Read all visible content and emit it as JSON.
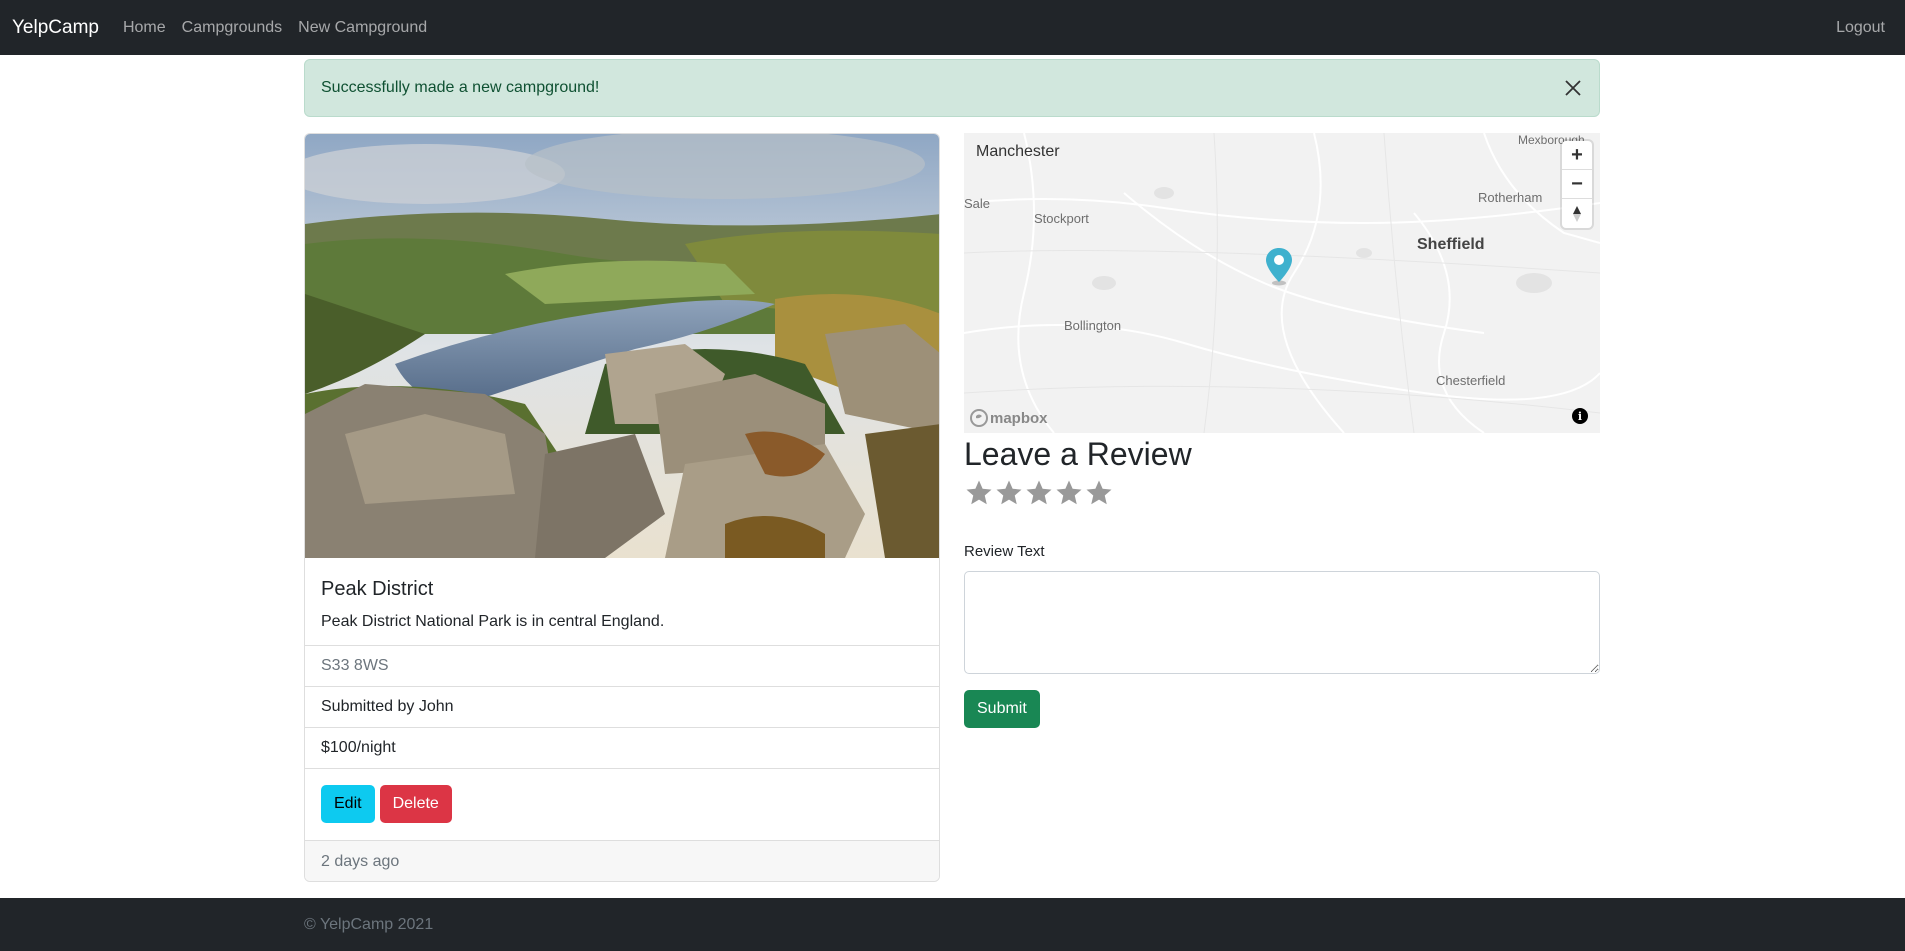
{
  "nav": {
    "brand": "YelpCamp",
    "links": [
      "Home",
      "Campgrounds",
      "New Campground"
    ],
    "logout": "Logout"
  },
  "alert": {
    "message": "Successfully made a new campground!"
  },
  "campground": {
    "title": "Peak District",
    "description": "Peak District National Park is in central England.",
    "location": "S33 8WS",
    "submitted_by": "Submitted by John",
    "price": "$100/night",
    "edit_label": "Edit",
    "delete_label": "Delete",
    "posted": "2 days ago"
  },
  "map": {
    "labels": {
      "manchester": "Manchester",
      "mexborough": "Mexborough",
      "sale": "Sale",
      "stockport": "Stockport",
      "rotherham": "Rotherham",
      "sheffield": "Sheffield",
      "bollington": "Bollington",
      "chesterfield": "Chesterfield"
    },
    "logo_text": "mapbox",
    "zoom_in": "+",
    "zoom_out": "−",
    "info": "i"
  },
  "review": {
    "heading": "Leave a Review",
    "rating_stars": 5,
    "text_label": "Review Text",
    "submit_label": "Submit"
  },
  "footer": {
    "text": "© YelpCamp 2021"
  },
  "colors": {
    "navbar": "#212529",
    "alert_bg": "#d1e7dd",
    "edit_btn": "#0dcaf0",
    "delete_btn": "#dc3545",
    "submit_btn": "#198754",
    "pin": "#3fb1ce"
  }
}
